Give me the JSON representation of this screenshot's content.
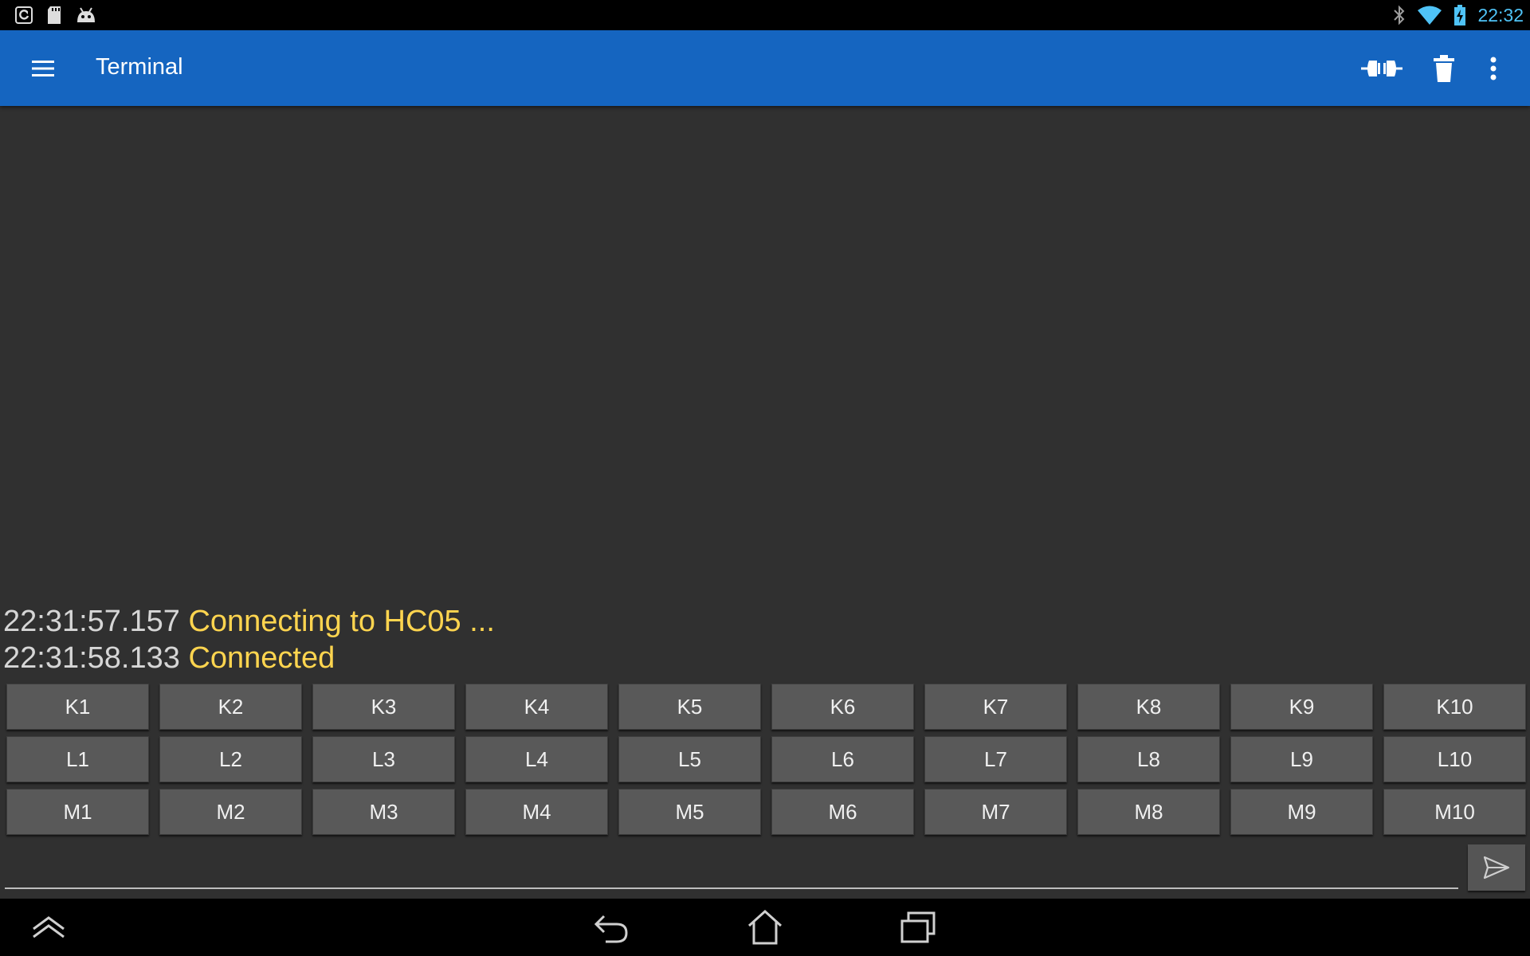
{
  "status_bar": {
    "time": "22:32",
    "left_icons": [
      "sync-icon",
      "sd-card-icon",
      "android-icon"
    ],
    "right_icons": [
      "bluetooth-icon",
      "wifi-icon",
      "battery-charging-icon"
    ]
  },
  "app_bar": {
    "title": "Terminal",
    "actions": [
      "connect-icon",
      "trash-icon",
      "more-vert-icon"
    ]
  },
  "terminal": {
    "lines": [
      {
        "timestamp": "22:31:57.157",
        "message": "Connecting to HC05 ..."
      },
      {
        "timestamp": "22:31:58.133",
        "message": "Connected"
      }
    ]
  },
  "macro_keys": {
    "row_k": [
      "K1",
      "K2",
      "K3",
      "K4",
      "K5",
      "K6",
      "K7",
      "K8",
      "K9",
      "K10"
    ],
    "row_l": [
      "L1",
      "L2",
      "L3",
      "L4",
      "L5",
      "L6",
      "L7",
      "L8",
      "L9",
      "L10"
    ],
    "row_m": [
      "M1",
      "M2",
      "M3",
      "M4",
      "M5",
      "M6",
      "M7",
      "M8",
      "M9",
      "M10"
    ]
  },
  "input": {
    "value": "",
    "placeholder": ""
  },
  "colors": {
    "app_bar": "#1565c0",
    "background": "#303030",
    "message": "#ffd54f",
    "timestamp": "#d6d6d6",
    "status_time": "#4fc3f7"
  }
}
